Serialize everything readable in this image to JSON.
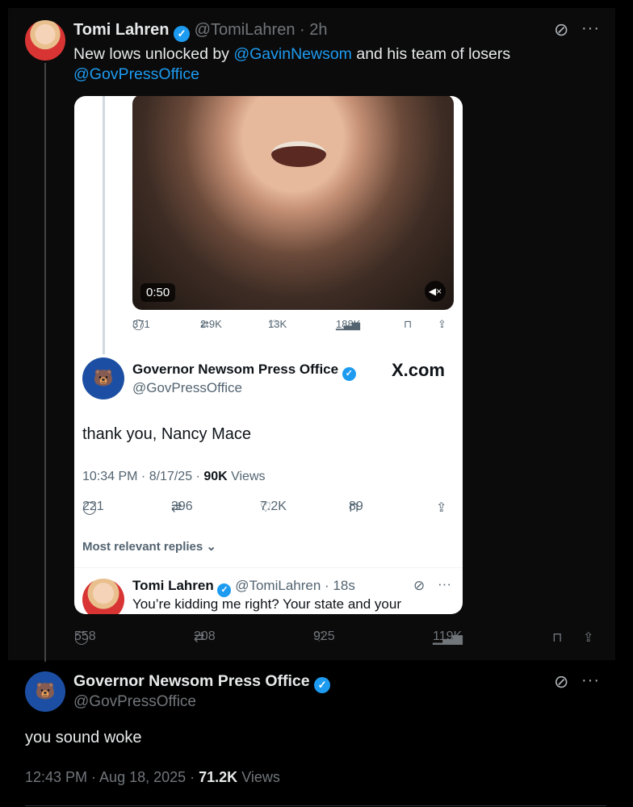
{
  "top_tweet": {
    "name": "Tomi Lahren",
    "handle": "@TomiLahren",
    "time": "· 2h",
    "text_before": "New lows unlocked by ",
    "mention1": "@GavinNewsom",
    "text_mid": " and his team of losers",
    "mention2": "@GovPressOffice"
  },
  "card": {
    "video_duration": "0:50",
    "inner_stats": {
      "replies": "371",
      "reposts": "2.9K",
      "likes": "13K",
      "views": "188K"
    },
    "author_name": "Governor Newsom Press Office",
    "author_handle": "@GovPressOffice",
    "brand": "X.com",
    "text": "thank you, Nancy Mace",
    "meta_time": "10:34 PM · 8/17/25 · ",
    "meta_views_num": "90K",
    "meta_views_label": " Views",
    "actions": {
      "replies": "221",
      "reposts": "396",
      "likes": "7.2K",
      "bookmarks": "89"
    },
    "relevant_label": "Most relevant replies",
    "reply": {
      "name": "Tomi Lahren",
      "handle": "@TomiLahren · 18s",
      "text": "You’re kidding me right? Your state and your"
    }
  },
  "outer_actions": {
    "replies": "558",
    "reposts": "208",
    "likes": "925",
    "views": "119K"
  },
  "reply_tweet": {
    "name": "Governor Newsom Press Office",
    "handle": "@GovPressOffice",
    "text": "you sound woke",
    "time": "12:43 PM · Aug 18, 2025 · ",
    "views_num": "71.2K",
    "views_label": " Views"
  },
  "colors": {
    "accent": "#1d9bf0",
    "background": "#000000",
    "muted": "#71767b"
  },
  "icons": [
    "verified-icon",
    "grok-icon",
    "more-icon",
    "reply-icon",
    "repost-icon",
    "like-icon",
    "views-icon",
    "bookmark-icon",
    "share-icon",
    "mute-icon"
  ]
}
